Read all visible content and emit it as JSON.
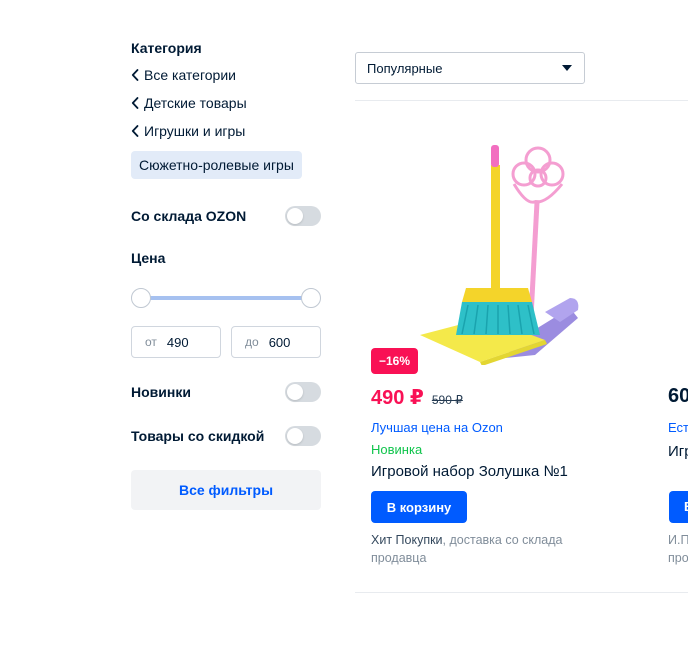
{
  "sidebar": {
    "category_title": "Категория",
    "links": [
      {
        "label": "Все категории"
      },
      {
        "label": "Детские товары"
      },
      {
        "label": "Игрушки и игры"
      }
    ],
    "active_category": "Сюжетно-ролевые игры",
    "ozon_stock_label": "Со склада OZON",
    "price_title": "Цена",
    "price_from_prefix": "от",
    "price_from_value": "490",
    "price_to_prefix": "до",
    "price_to_value": "600",
    "new_label": "Новинки",
    "discount_label": "Товары со скидкой",
    "all_filters_label": "Все фильтры"
  },
  "sort": {
    "selected": "Популярные"
  },
  "product": {
    "discount_badge": "−16%",
    "price": "490 ₽",
    "old_price": "590 ₽",
    "best_price_label": "Лучшая цена на Ozon",
    "novelty_label": "Новинка",
    "name": "Игровой набор Золушка №1",
    "cart_button": "В корзину",
    "seller_brand": "Хит Покупки",
    "seller_rest": ", доставка со склада продавца"
  },
  "next_product": {
    "price_partial": "60",
    "line1_partial": "Ест",
    "name_partial": "Игр",
    "button_partial": "В",
    "seller_line1_partial": "И.П",
    "seller_line2_partial": "про"
  },
  "colors": {
    "accent": "#005bff",
    "sale": "#f91155",
    "novelty": "#10c44c",
    "text": "#001a34",
    "muted": "#808d9a"
  }
}
